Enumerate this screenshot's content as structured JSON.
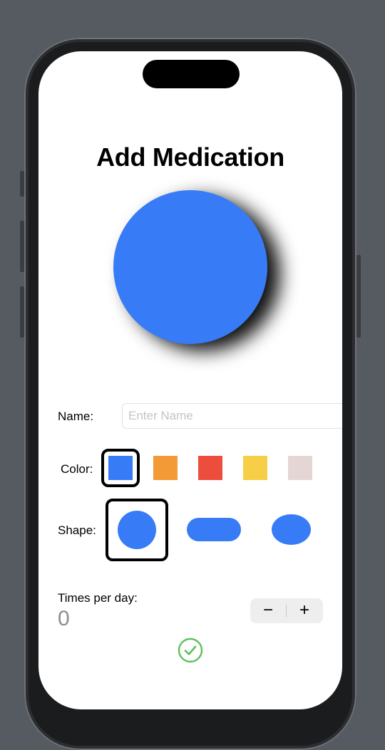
{
  "page": {
    "title": "Add Medication"
  },
  "preview": {
    "shape": "circle",
    "color": "#377cf6"
  },
  "name_field": {
    "label": "Name:",
    "value": "",
    "placeholder": "Enter Name"
  },
  "color_picker": {
    "label": "Color:",
    "selected_index": 0,
    "options": [
      "#377cf6",
      "#f39a36",
      "#ec4d3d",
      "#f6cf46",
      "#e4d6d4"
    ]
  },
  "shape_picker": {
    "label": "Shape:",
    "selected_index": 0,
    "options": [
      "circle-icon",
      "capsule-icon",
      "oval-icon"
    ]
  },
  "frequency": {
    "label": "Times per day:",
    "value": "0",
    "decrement_label": "−",
    "increment_label": "+"
  },
  "confirm": {
    "icon": "checkmark-circle-icon",
    "color": "#5cc05c"
  }
}
